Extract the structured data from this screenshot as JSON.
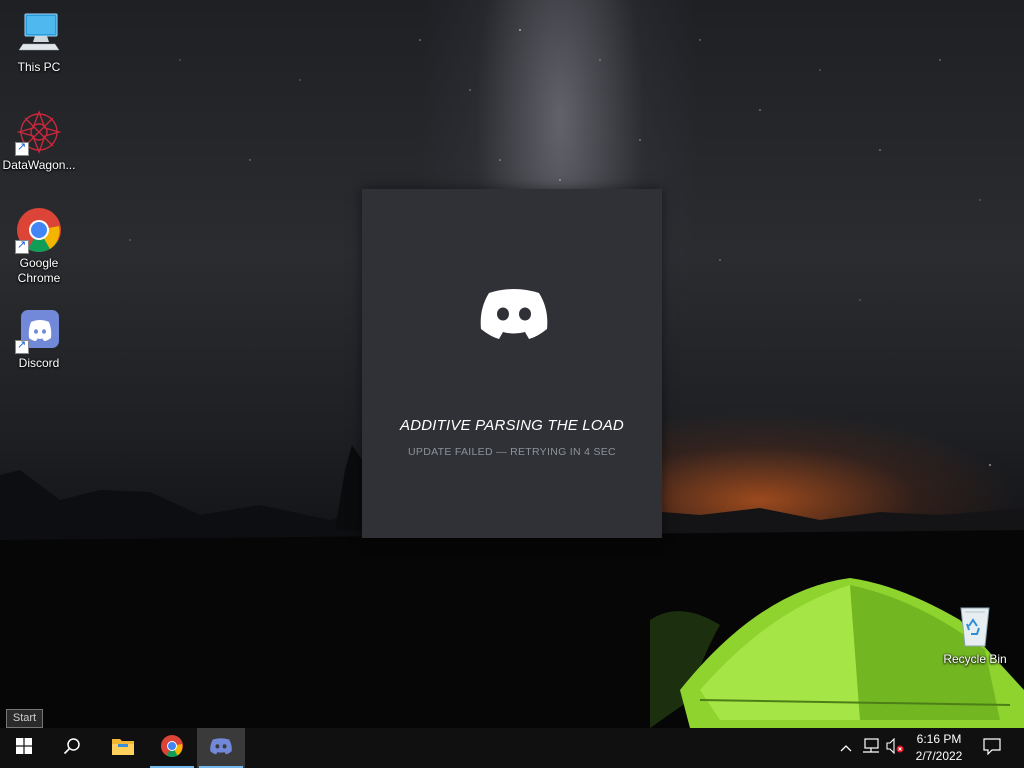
{
  "desktop": {
    "icons": [
      {
        "label": "This PC",
        "icon": "computer-icon"
      },
      {
        "label": "DataWagon...",
        "icon": "datawagon-icon"
      },
      {
        "label": "Google Chrome",
        "icon": "chrome-icon"
      },
      {
        "label": "Discord",
        "icon": "discord-icon"
      },
      {
        "label": "Recycle Bin",
        "icon": "recycle-bin-icon"
      }
    ]
  },
  "splash": {
    "title": "ADDITIVE PARSING THE LOAD",
    "status": "UPDATE FAILED — RETRYING IN 4 SEC",
    "background": "#2f3136"
  },
  "tooltip": {
    "text": "Start"
  },
  "taskbar": {
    "buttons": [
      {
        "icon": "windows-start-icon"
      },
      {
        "icon": "search-icon"
      },
      {
        "icon": "file-explorer-icon"
      },
      {
        "icon": "chrome-icon"
      },
      {
        "icon": "discord-icon"
      }
    ],
    "tray": {
      "icons": [
        "chevron-up-icon",
        "network-icon",
        "volume-muted-icon"
      ],
      "time": "6:16 PM",
      "date": "2/7/2022",
      "notification_icon": "action-center-icon"
    },
    "accent": "#76b9ed"
  }
}
